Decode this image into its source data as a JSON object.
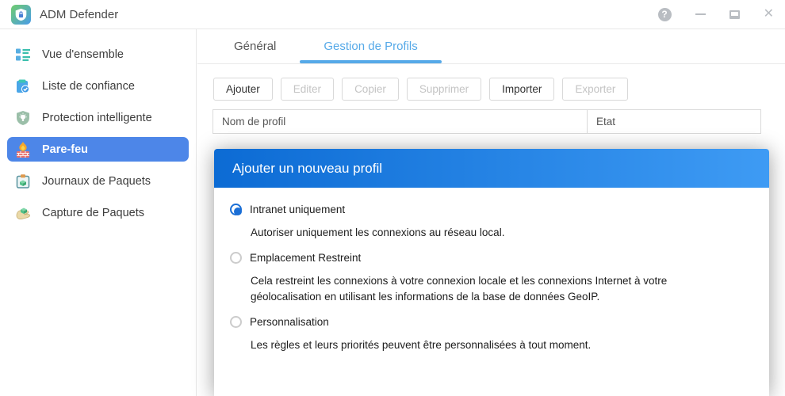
{
  "window": {
    "title": "ADM Defender",
    "controls": {
      "help": "?",
      "close": "✕"
    }
  },
  "sidebar": {
    "items": [
      {
        "label": "Vue d'ensemble",
        "selected": false
      },
      {
        "label": "Liste de confiance",
        "selected": false
      },
      {
        "label": "Protection intelligente",
        "selected": false
      },
      {
        "label": "Pare-feu",
        "selected": true
      },
      {
        "label": "Journaux de Paquets",
        "selected": false
      },
      {
        "label": "Capture de Paquets",
        "selected": false
      }
    ]
  },
  "tabs": [
    {
      "label": "Général",
      "active": false
    },
    {
      "label": "Gestion de Profils",
      "active": true
    }
  ],
  "toolbar": {
    "buttons": [
      {
        "label": "Ajouter",
        "enabled": true
      },
      {
        "label": "Editer",
        "enabled": false
      },
      {
        "label": "Copier",
        "enabled": false
      },
      {
        "label": "Supprimer",
        "enabled": false
      },
      {
        "label": "Importer",
        "enabled": true
      },
      {
        "label": "Exporter",
        "enabled": false
      }
    ]
  },
  "table": {
    "columns": [
      "Nom de profil",
      "Etat"
    ],
    "rows": []
  },
  "modal": {
    "title": "Ajouter un nouveau profil",
    "options": [
      {
        "label": "Intranet uniquement",
        "selected": true,
        "description": "Autoriser uniquement les connexions au réseau local."
      },
      {
        "label": "Emplacement Restreint",
        "selected": false,
        "description": "Cela restreint les connexions à votre connexion locale et les connexions Internet à votre géolocalisation en utilisant les informations de la base de données GeoIP."
      },
      {
        "label": "Personnalisation",
        "selected": false,
        "description": "Les règles et leurs priorités peuvent être personnalisées à tout moment."
      }
    ]
  },
  "colors": {
    "sidebar_selected": "#4d86e8",
    "tab_active": "#55a9e8",
    "modal_header_start": "#0c6bd4",
    "modal_header_end": "#3e9bf4",
    "radio_selected": "#1b6fd6"
  }
}
